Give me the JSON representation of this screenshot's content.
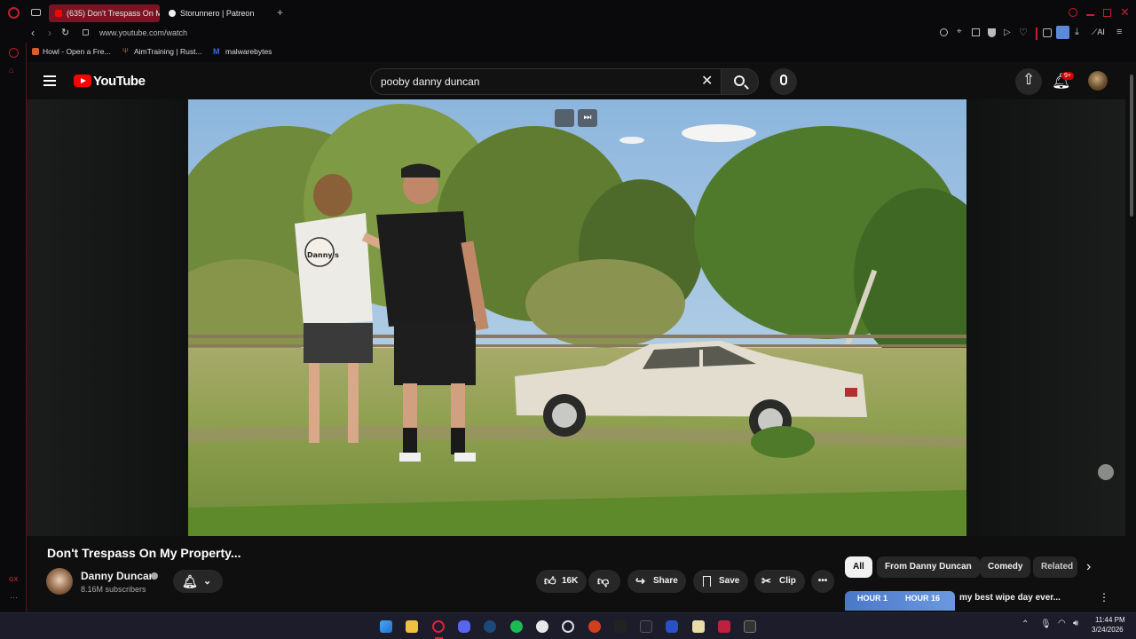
{
  "browser": {
    "tabs": [
      {
        "label": "(635) Don't Trespass On M",
        "active": true
      },
      {
        "label": "Storunnero | Patreon",
        "active": false
      }
    ],
    "new_tab_label": "+",
    "url": "www.youtube.com/watch",
    "bookmarks": [
      "Howl - Open a Fre...",
      "AimTraining | Rust...",
      "malwarebytes"
    ],
    "toolbar_ai_label": "AI"
  },
  "youtube": {
    "logo_text": "YouTube",
    "search": {
      "value": "pooby danny duncan"
    },
    "notification_badge": "9+",
    "video": {
      "title": "Don't Trespass On My Property...",
      "channel": "Danny Duncan",
      "subscribers": "8.16M subscribers",
      "likes": "16K",
      "share_label": "Share",
      "save_label": "Save",
      "clip_label": "Clip",
      "shirt_text": "Danny's"
    },
    "chips": [
      "All",
      "From Danny Duncan",
      "Comedy",
      "Related"
    ],
    "recommended": {
      "title": "my best wipe day ever...",
      "thumb_text_left": "HOUR 1",
      "thumb_text_right": "HOUR 16"
    }
  },
  "taskbar": {
    "time": "11:44 PM",
    "date": "3/24/2026"
  },
  "colors": {
    "brand_red": "#ff0000",
    "opera_red": "#b3202f",
    "background": "#0f0f0f"
  }
}
